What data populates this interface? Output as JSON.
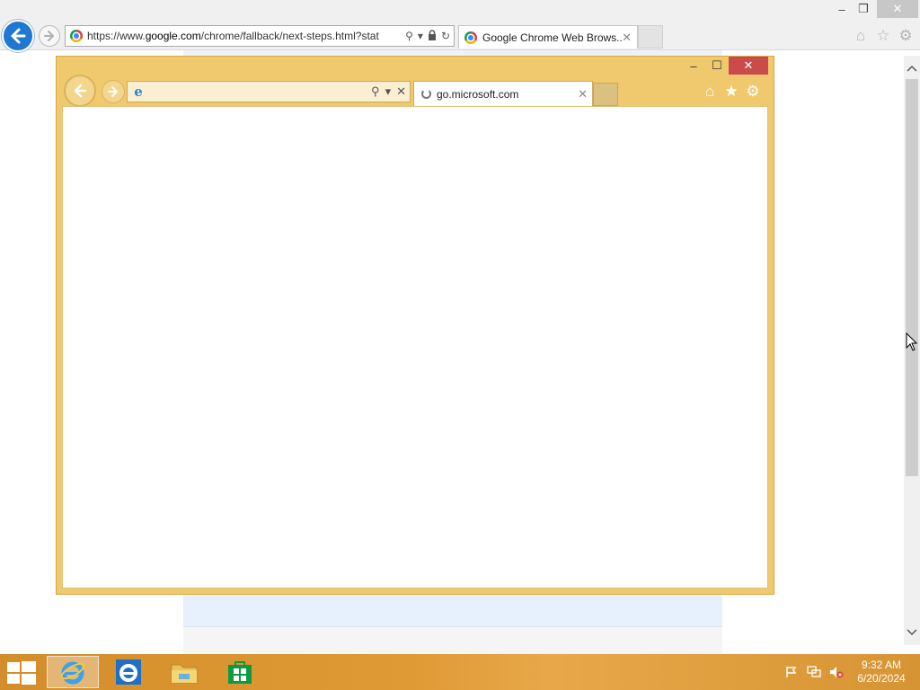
{
  "outer_window": {
    "address_url_prefix": "https://www.",
    "address_url_domain": "google.com",
    "address_url_rest": "/chrome/fallback/next-steps.html?stat",
    "tab_title": "Google Chrome Web Brows...",
    "icons": [
      "back-arrow-icon",
      "forward-arrow-icon",
      "chrome-logo-icon",
      "search-icon",
      "dropdown-icon",
      "lock-icon",
      "refresh-icon",
      "home-icon",
      "favorites-star-icon",
      "gear-icon"
    ]
  },
  "inner_window": {
    "address_value": "",
    "tab_title": "go.microsoft.com",
    "icons": [
      "back-arrow-icon",
      "forward-arrow-icon",
      "ie-logo-icon",
      "search-icon",
      "dropdown-icon",
      "stop-icon",
      "loading-spinner-icon",
      "home-icon",
      "favorites-star-icon",
      "gear-icon"
    ]
  },
  "taskbar": {
    "clock_time": "9:32 AM",
    "clock_date": "6/20/2024",
    "apps": [
      "internet-explorer",
      "internet-explorer",
      "file-explorer",
      "windows-store"
    ],
    "tray": [
      "action-center-flag-icon",
      "network-icon",
      "volume-muted-icon"
    ]
  },
  "colors": {
    "inner_frame": "#f0c96e",
    "outer_back_button": "#1f79d3",
    "taskbar": "#e09a35",
    "inner_close": "#c94b4b"
  }
}
